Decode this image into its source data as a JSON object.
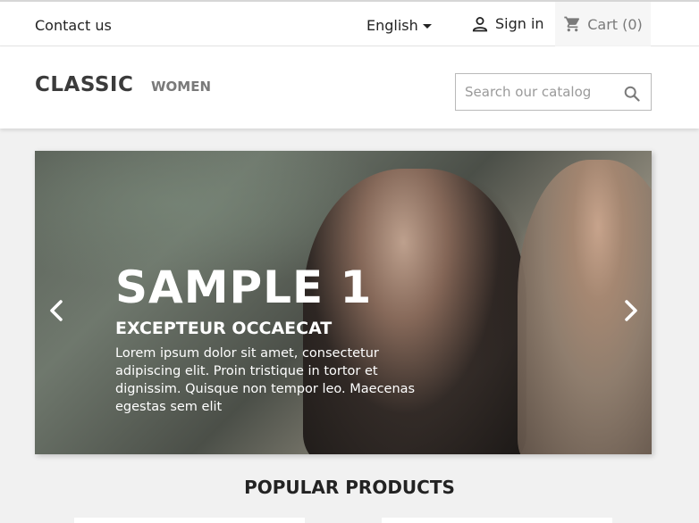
{
  "topbar": {
    "contact_label": "Contact us",
    "language_label": "English",
    "signin_label": "Sign in",
    "cart_label": "Cart",
    "cart_count": "(0)",
    "icons": {
      "user": "user-icon",
      "cart": "cart-icon",
      "caret": "chevron-down-icon"
    }
  },
  "header": {
    "logo_text": "CLASSIC",
    "nav": [
      {
        "label": "WOMEN"
      }
    ],
    "search": {
      "placeholder": "Search our catalog",
      "value": "",
      "icon": "search-icon"
    }
  },
  "slider": {
    "title": "SAMPLE 1",
    "subtitle": "EXCEPTEUR OCCAECAT",
    "text": "Lorem ipsum dolor sit amet, consectetur adipiscing elit. Proin tristique in tortor et dignissim. Quisque non tempor leo. Maecenas egestas sem elit",
    "prev_icon": "chevron-left-icon",
    "next_icon": "chevron-right-icon"
  },
  "popular": {
    "heading": "POPULAR PRODUCTS"
  },
  "colors": {
    "text": "#232323",
    "muted": "#7a7a7a",
    "background": "#f1f1f1"
  }
}
